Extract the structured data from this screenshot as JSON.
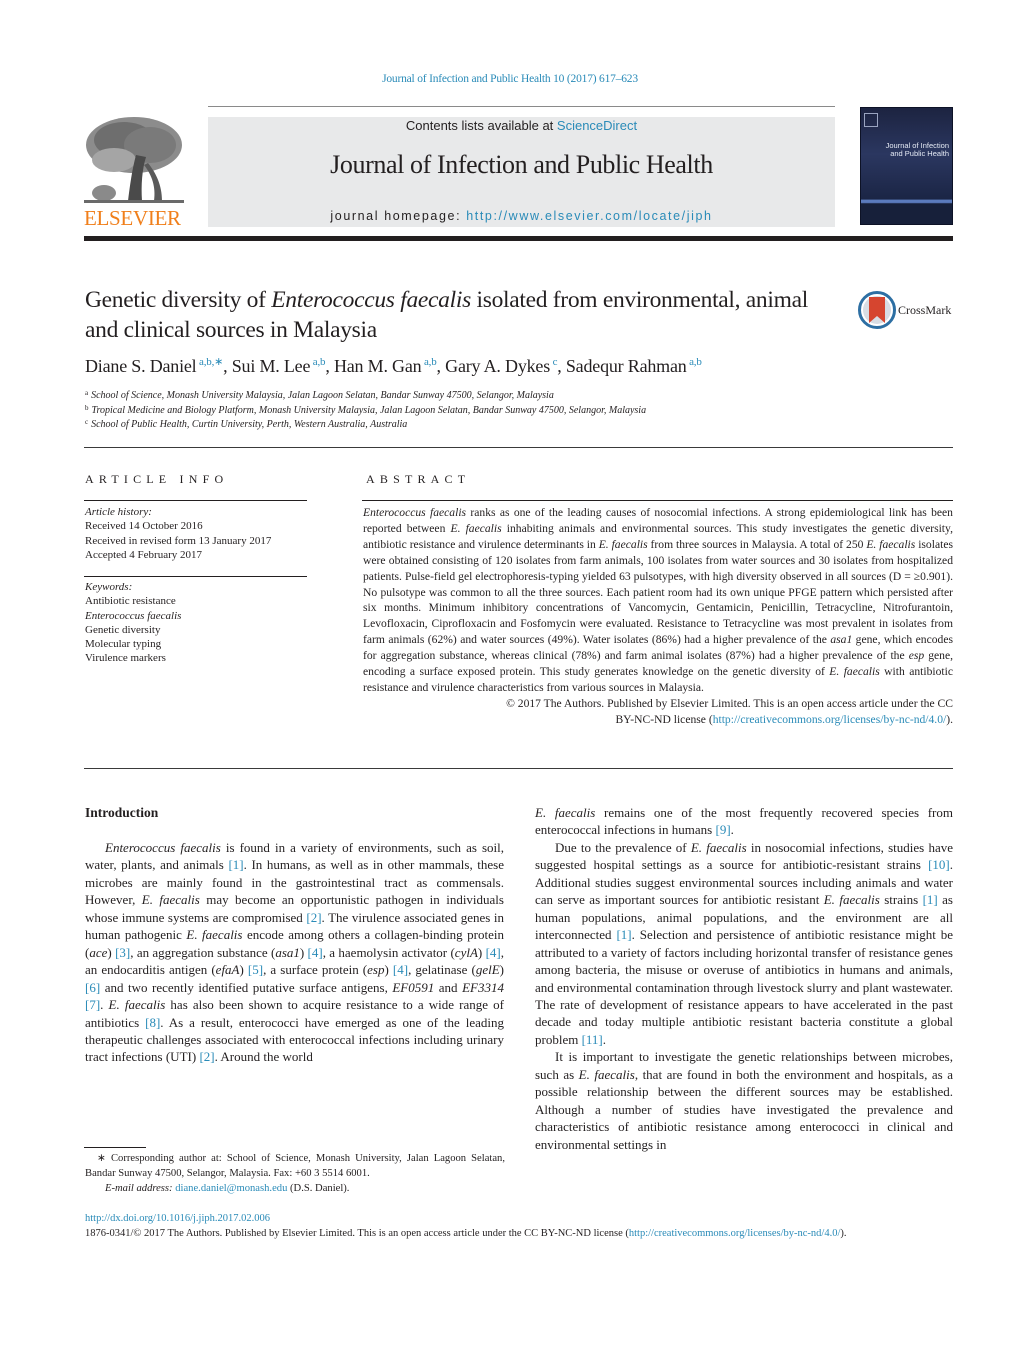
{
  "running_header": "Journal of Infection and Public Health 10 (2017) 617–623",
  "masthead": {
    "publisher_logo_text": "ELSEVIER",
    "contents_prefix": "Contents lists available at ",
    "contents_link": "ScienceDirect",
    "journal_name": "Journal of Infection and Public Health",
    "homepage_prefix": "journal homepage: ",
    "homepage_url": "http://www.elsevier.com/locate/jiph",
    "cover_title_line1": "Journal of Infection",
    "cover_title_line2": "and Public Health",
    "colors": {
      "link": "#2a8bb8",
      "elsevier_orange": "#f07f1b",
      "banner_bg": "#e8e9ea",
      "crossmark_red": "#d6452f",
      "crossmark_blue": "#2d6fa3"
    }
  },
  "article": {
    "title_part1": "Genetic diversity of ",
    "title_italic": "Enterococcus faecalis",
    "title_part2": " isolated from environmental, animal and clinical sources in Malaysia",
    "crossmark_label": "CrossMark",
    "authors": [
      {
        "name": "Diane S. Daniel",
        "sup": "a,b,∗",
        "sep": ", "
      },
      {
        "name": "Sui M. Lee",
        "sup": "a,b",
        "sep": ", "
      },
      {
        "name": "Han M. Gan",
        "sup": "a,b",
        "sep": ", "
      },
      {
        "name": "Gary A. Dykes",
        "sup": "c",
        "sep": ", "
      },
      {
        "name": "Sadequr Rahman",
        "sup": "a,b",
        "sep": ""
      }
    ],
    "affiliations": [
      {
        "key": "a",
        "text": "School of Science, Monash University Malaysia, Jalan Lagoon Selatan, Bandar Sunway 47500, Selangor, Malaysia"
      },
      {
        "key": "b",
        "text": "Tropical Medicine and Biology Platform, Monash University Malaysia, Jalan Lagoon Selatan, Bandar Sunway 47500, Selangor, Malaysia"
      },
      {
        "key": "c",
        "text": "School of Public Health, Curtin University, Perth, Western Australia, Australia"
      }
    ]
  },
  "article_info": {
    "heading": "ARTICLE INFO",
    "history_label": "Article history:",
    "history": [
      "Received 14 October 2016",
      "Received in revised form 13 January 2017",
      "Accepted 4 February 2017"
    ],
    "keywords_label": "Keywords:",
    "keywords": [
      "Antibiotic resistance",
      "Enterococcus faecalis",
      "Genetic diversity",
      "Molecular typing",
      "Virulence markers"
    ]
  },
  "abstract": {
    "heading": "ABSTRACT",
    "segments": [
      {
        "t": "Enterococcus faecalis",
        "i": true
      },
      {
        "t": " ranks as one of the leading causes of nosocomial infections. A strong epidemiological link has been reported between "
      },
      {
        "t": "E. faecalis",
        "i": true
      },
      {
        "t": " inhabiting animals and environmental sources. This study investigates the genetic diversity, antibiotic resistance and virulence determinants in "
      },
      {
        "t": "E. faecalis",
        "i": true
      },
      {
        "t": " from three sources in Malaysia. A total of 250 "
      },
      {
        "t": "E. faecalis",
        "i": true
      },
      {
        "t": " isolates were obtained consisting of 120 isolates from farm animals, 100 isolates from water sources and 30 isolates from hospitalized patients. Pulse-field gel electrophoresis-typing yielded 63 pulsotypes, with high diversity observed in all sources (D = ≥0.901). No pulsotype was common to all the three sources. Each patient room had its own unique PFGE pattern which persisted after six months. Minimum inhibitory concentrations of Vancomycin, Gentamicin, Penicillin, Tetracycline, Nitrofurantoin, Levofloxacin, Ciprofloxacin and Fosfomycin were evaluated. Resistance to Tetracycline was most prevalent in isolates from farm animals (62%) and water sources (49%). Water isolates (86%) had a higher prevalence of the "
      },
      {
        "t": "asa1",
        "i": true
      },
      {
        "t": " gene, which encodes for aggregation substance, whereas clinical (78%) and farm animal isolates (87%) had a higher prevalence of the "
      },
      {
        "t": "esp",
        "i": true
      },
      {
        "t": " gene, encoding a surface exposed protein. This study generates knowledge on the genetic diversity of "
      },
      {
        "t": "E. faecalis",
        "i": true
      },
      {
        "t": " with antibiotic resistance and virulence characteristics from various sources in Malaysia."
      }
    ],
    "copyright_line1": "© 2017 The Authors. Published by Elsevier Limited. This is an open access article under the CC",
    "copyright_line2_prefix": "BY-NC-ND license (",
    "license_url": "http://creativecommons.org/licenses/by-nc-nd/4.0/",
    "copyright_line2_suffix": ")."
  },
  "body": {
    "intro_heading": "Introduction",
    "left_column": [
      {
        "t": "Enterococcus faecalis",
        "i": true
      },
      {
        "t": " is found in a variety of environments, such as soil, water, plants, and animals "
      },
      {
        "t": "[1]",
        "ref": true
      },
      {
        "t": ". In humans, as well as in other mammals, these microbes are mainly found in the gastrointestinal tract as commensals. However, "
      },
      {
        "t": "E. faecalis",
        "i": true
      },
      {
        "t": " may become an opportunistic pathogen in individuals whose immune systems are compromised "
      },
      {
        "t": "[2]",
        "ref": true
      },
      {
        "t": ". The virulence associated genes in human pathogenic "
      },
      {
        "t": "E. faecalis",
        "i": true
      },
      {
        "t": " encode among others a collagen-binding protein ("
      },
      {
        "t": "ace",
        "i": true
      },
      {
        "t": ") "
      },
      {
        "t": "[3]",
        "ref": true
      },
      {
        "t": ", an aggregation substance ("
      },
      {
        "t": "asa1",
        "i": true
      },
      {
        "t": ") "
      },
      {
        "t": "[4]",
        "ref": true
      },
      {
        "t": ", a haemolysin activator ("
      },
      {
        "t": "cylA",
        "i": true
      },
      {
        "t": ") "
      },
      {
        "t": "[4]",
        "ref": true
      },
      {
        "t": ", an endocarditis antigen ("
      },
      {
        "t": "efaA",
        "i": true
      },
      {
        "t": ") "
      },
      {
        "t": "[5]",
        "ref": true
      },
      {
        "t": ", a surface protein ("
      },
      {
        "t": "esp",
        "i": true
      },
      {
        "t": ") "
      },
      {
        "t": "[4]",
        "ref": true
      },
      {
        "t": ", gelatinase ("
      },
      {
        "t": "gelE",
        "i": true
      },
      {
        "t": ") "
      },
      {
        "t": "[6]",
        "ref": true
      },
      {
        "t": " and two recently identified putative surface antigens, "
      },
      {
        "t": "EF0591",
        "i": true
      },
      {
        "t": " and "
      },
      {
        "t": "EF3314",
        "i": true
      },
      {
        "t": " "
      },
      {
        "t": "[7]",
        "ref": true
      },
      {
        "t": ". "
      },
      {
        "t": "E. faecalis",
        "i": true
      },
      {
        "t": " has also been shown to acquire resistance to a wide range of antibiotics "
      },
      {
        "t": "[8]",
        "ref": true
      },
      {
        "t": ". As a result, enterococci have emerged as one of the leading therapeutic challenges associated with enterococcal infections including urinary tract infections (UTI) "
      },
      {
        "t": "[2]",
        "ref": true
      },
      {
        "t": ". Around the world"
      }
    ],
    "right_paragraphs": [
      {
        "indent": false,
        "segments": [
          {
            "t": "E. faecalis",
            "i": true
          },
          {
            "t": " remains one of the most frequently recovered species from enterococcal infections in humans "
          },
          {
            "t": "[9]",
            "ref": true
          },
          {
            "t": "."
          }
        ]
      },
      {
        "indent": true,
        "segments": [
          {
            "t": "Due to the prevalence of "
          },
          {
            "t": "E. faecalis",
            "i": true
          },
          {
            "t": " in nosocomial infections, studies have suggested hospital settings as a source for antibiotic-resistant strains "
          },
          {
            "t": "[10]",
            "ref": true
          },
          {
            "t": ". Additional studies suggest environmental sources including animals and water can serve as important sources for antibiotic resistant "
          },
          {
            "t": "E. faecalis",
            "i": true
          },
          {
            "t": " strains "
          },
          {
            "t": "[1]",
            "ref": true
          },
          {
            "t": " as human populations, animal populations, and the environment are all interconnected "
          },
          {
            "t": "[1]",
            "ref": true
          },
          {
            "t": ". Selection and persistence of antibiotic resistance might be attributed to a variety of factors including horizontal transfer of resistance genes among bacteria, the misuse or overuse of antibiotics in humans and animals, and environmental contamination through livestock slurry and plant wastewater. The rate of development of resistance appears to have accelerated in the past decade and today multiple antibiotic resistant bacteria constitute a global problem "
          },
          {
            "t": "[11]",
            "ref": true
          },
          {
            "t": "."
          }
        ]
      },
      {
        "indent": true,
        "segments": [
          {
            "t": "It is important to investigate the genetic relationships between microbes, such as "
          },
          {
            "t": "E. faecalis",
            "i": true
          },
          {
            "t": ", that are found in both the environment and hospitals, as a possible relationship between the different sources may be established. Although a number of studies have investigated the prevalence and characteristics of antibiotic resistance among enterococci in clinical and environmental settings in"
          }
        ]
      }
    ]
  },
  "footnote": {
    "marker": "∗",
    "text": " Corresponding author at: School of Science, Monash University, Jalan Lagoon Selatan, Bandar Sunway 47500, Selangor, Malaysia. Fax: +60 3 5514 6001.",
    "email_label": "E-mail address:",
    "email": "diane.daniel@monash.edu",
    "email_suffix": " (D.S. Daniel)."
  },
  "doi_block": {
    "doi_url": "http://dx.doi.org/10.1016/j.jiph.2017.02.006",
    "license_prefix": "1876-0341/© 2017 The Authors. Published by Elsevier Limited. This is an open access article under the CC BY-NC-ND license (",
    "license_url": "http://creativecommons.org/licenses/by-nc-nd/4.0/",
    "license_suffix": ")."
  }
}
